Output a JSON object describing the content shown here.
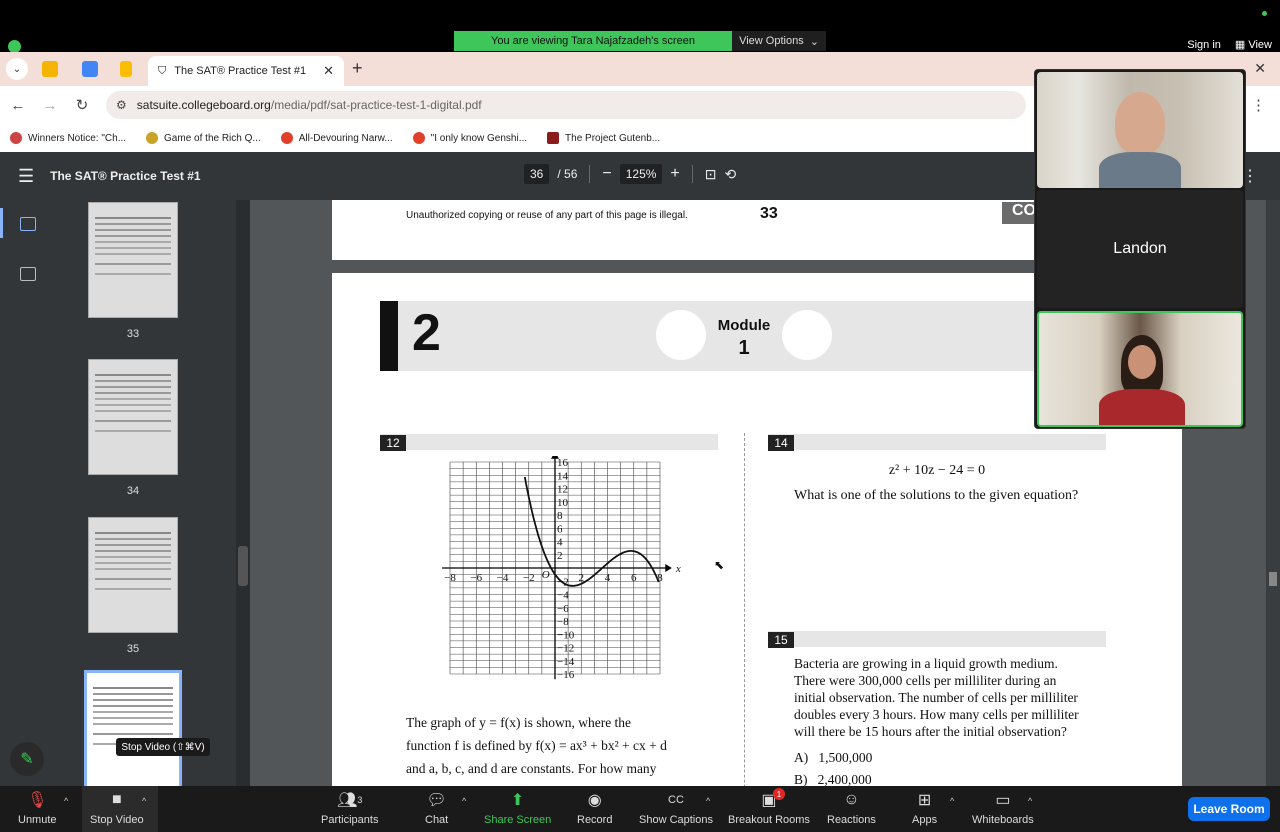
{
  "zoom_top": {
    "banner_text": "You are viewing Tara Najafzadeh's screen",
    "view_options": "View Options",
    "sign_in": "Sign in",
    "view": "View"
  },
  "browser": {
    "tab_title": "The SAT® Practice Test #1",
    "url_host": "satsuite.collegeboard.org",
    "url_path": "/media/pdf/sat-practice-test-1-digital.pdf",
    "bookmarks": [
      {
        "label": "Winners Notice: \"Ch...",
        "color": "#c44"
      },
      {
        "label": "Game of the Rich Q...",
        "color": "#c9a227"
      },
      {
        "label": "All-Devouring Narw...",
        "color": "#e0402b"
      },
      {
        "label": "\"I only know Genshi...",
        "color": "#e0402b"
      },
      {
        "label": "The Project Gutenb...",
        "color": "#8a1c1c"
      }
    ]
  },
  "pdf": {
    "title": "The SAT® Practice Test #1",
    "current_page": "36",
    "total_pages": "/ 56",
    "zoom": "125%",
    "thumb_labels": [
      "33",
      "34",
      "35"
    ],
    "page_top": {
      "copyright": "Unauthorized copying or reuse of any part of this page is illegal.",
      "page_number": "33",
      "continue": "CO"
    },
    "module": {
      "section_number": "2",
      "label": "Module",
      "number": "1"
    },
    "q12": {
      "number": "12",
      "text_lines": [
        "The graph of y = f(x) is shown, where the",
        "function f is defined by f(x) = ax³ + bx² + cx + d",
        "and a, b, c, and d are constants. For how many"
      ],
      "axis_x": "x",
      "axis_y": "y",
      "origin": "O",
      "x_ticks": [
        "−8",
        "−6",
        "−4",
        "−2",
        "2",
        "4",
        "6",
        "8"
      ],
      "y_ticks": [
        "16",
        "14",
        "12",
        "10",
        "8",
        "6",
        "4",
        "2",
        "−2",
        "−4",
        "−6",
        "−8",
        "−10",
        "−12",
        "−14",
        "−16"
      ]
    },
    "q14": {
      "number": "14",
      "equation": "z² + 10z − 24 = 0",
      "question": "What is one of the solutions to the given equation?"
    },
    "q15": {
      "number": "15",
      "text_lines": [
        "Bacteria are growing in a liquid growth medium.",
        "There were 300,000 cells per milliliter during an",
        "initial observation. The number of cells per milliliter",
        "doubles every 3 hours. How many cells per milliliter",
        "will there be 15 hours after the initial observation?"
      ],
      "choices": [
        "A)   1,500,000",
        "B)   2,400,000"
      ]
    }
  },
  "video": {
    "participant_name": "Landon"
  },
  "tooltip": "Stop Video (⇧⌘V)",
  "toolbar": {
    "unmute": "Unmute",
    "stop_video": "Stop Video",
    "participants": "Participants",
    "participants_count": "3",
    "chat": "Chat",
    "share_screen": "Share Screen",
    "record": "Record",
    "show_captions": "Show Captions",
    "breakout_rooms": "Breakout Rooms",
    "breakout_badge": "1",
    "reactions": "Reactions",
    "apps": "Apps",
    "whiteboards": "Whiteboards",
    "leave_room": "Leave Room"
  }
}
